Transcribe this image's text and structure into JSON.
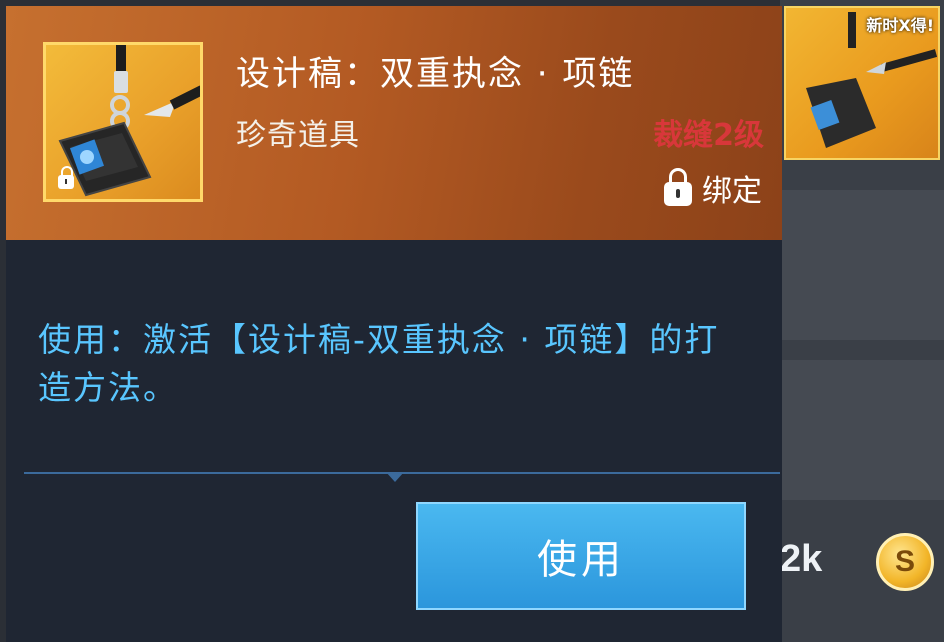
{
  "item": {
    "title": "设计稿：双重执念 · 项链",
    "category": "珍奇道具",
    "level": "裁缝2级",
    "bind_label": "绑定",
    "description": "使用：激活【设计稿-双重执念 · 项链】的打造方法。",
    "icon": "necklace-design-icon",
    "colors": {
      "header_gradient_start": "#c6702f",
      "item_frame": "#f3bb3a",
      "level_text": "#d8373a",
      "description_text": "#59c6ff",
      "button": "#2b96dc"
    }
  },
  "actions": {
    "use_label": "使用"
  },
  "background": {
    "side_item_tag": "新时X得!",
    "price_text": "2k",
    "coin_symbol": "S"
  }
}
